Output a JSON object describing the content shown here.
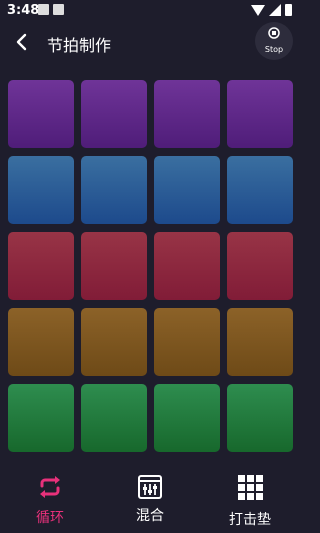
{
  "status_bar": {
    "time": "3:48"
  },
  "header": {
    "title": "节拍制作",
    "stop_label": "Stop"
  },
  "pads": {
    "rows": [
      {
        "color": "purple",
        "top": "#6f3498",
        "bottom": "#4f1d79",
        "count": 4
      },
      {
        "color": "blue",
        "top": "#3a6fa0",
        "bottom": "#1d4a8c",
        "count": 4
      },
      {
        "color": "red",
        "top": "#983446",
        "bottom": "#811c37",
        "count": 4
      },
      {
        "color": "orange",
        "top": "#8c6228",
        "bottom": "#6e4a17",
        "count": 4
      },
      {
        "color": "green",
        "top": "#2e8d4f",
        "bottom": "#17682c",
        "count": 4
      }
    ]
  },
  "bottom_nav": {
    "items": [
      {
        "label": "循环",
        "icon": "loop-icon",
        "active": true,
        "color": "#e8317b"
      },
      {
        "label": "混合",
        "icon": "mixer-icon",
        "active": false,
        "color": "#ffffff"
      },
      {
        "label": "打击垫",
        "icon": "grid-icon",
        "active": false,
        "color": "#ffffff"
      }
    ]
  }
}
